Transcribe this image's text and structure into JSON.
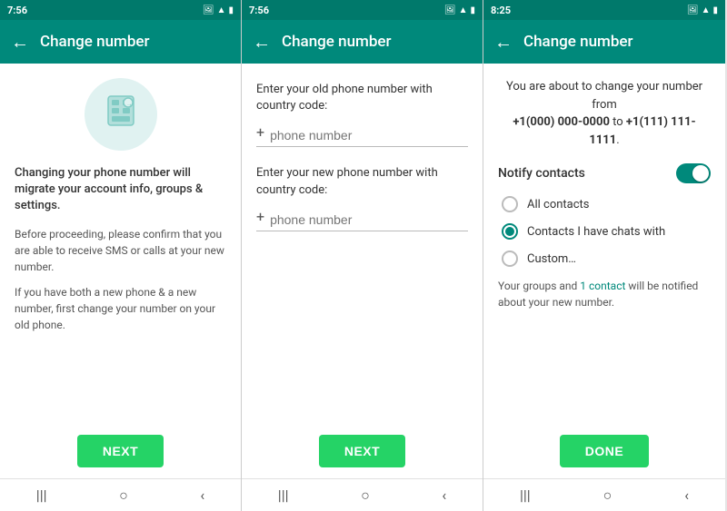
{
  "panels": [
    {
      "id": "panel1",
      "statusBar": {
        "time": "7:56",
        "icons": [
          "image",
          "battery"
        ]
      },
      "header": {
        "backLabel": "←",
        "title": "Change number"
      },
      "iconAlt": "phone-change-icon",
      "mainDescription": "Changing your phone number will migrate your account info, groups & settings.",
      "subDescriptions": [
        "Before proceeding, please confirm that you are able to receive SMS or calls at your new number.",
        "If you have both a new phone & a new number, first change your number on your old phone."
      ],
      "buttonLabel": "NEXT"
    },
    {
      "id": "panel2",
      "statusBar": {
        "time": "7:56",
        "icons": [
          "image",
          "battery"
        ]
      },
      "header": {
        "backLabel": "←",
        "title": "Change number"
      },
      "oldNumberLabel": "Enter your old phone number with country code:",
      "newNumberLabel": "Enter your new phone number with country code:",
      "phoneInputPlaceholder": "phone number",
      "buttonLabel": "NEXT"
    },
    {
      "id": "panel3",
      "statusBar": {
        "time": "8:25",
        "icons": [
          "image",
          "battery"
        ]
      },
      "header": {
        "backLabel": "←",
        "title": "Change number"
      },
      "infoText": "You are about to change your number from",
      "oldNumber": "+1(000) 000-0000",
      "toText": "to",
      "newNumber": "+1(111) 111-1111",
      "notifyContactsLabel": "Notify contacts",
      "radioOptions": [
        {
          "label": "All contacts",
          "selected": false
        },
        {
          "label": "Contacts I have chats with",
          "selected": true
        },
        {
          "label": "Custom…",
          "selected": false
        }
      ],
      "groupsText": "Your groups and ",
      "contactLink": "1 contact",
      "groupsTextEnd": " will be notified about your new number.",
      "buttonLabel": "DONE"
    }
  ],
  "navIcons": [
    "|||",
    "○",
    "<"
  ]
}
